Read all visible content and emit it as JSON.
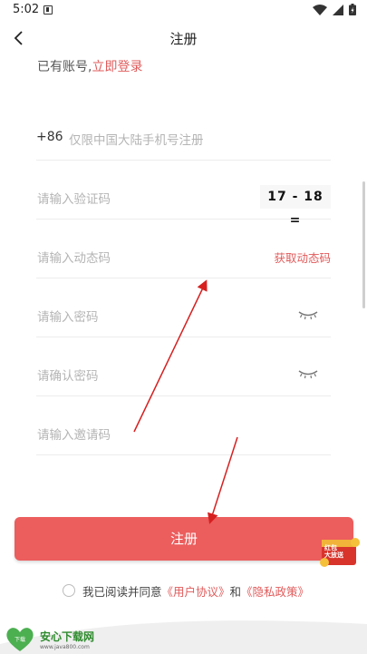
{
  "statusbar": {
    "time": "5:02"
  },
  "nav": {
    "title": "注册"
  },
  "login_hint": {
    "text": "已有账号,",
    "link": "立即登录"
  },
  "phone": {
    "prefix": "+86",
    "placeholder": "仅限中国大陆手机号注册"
  },
  "captcha": {
    "placeholder": "请输入验证码",
    "image_text": "17 - 18 ="
  },
  "dynamic_code": {
    "placeholder": "请输入动态码",
    "button": "获取动态码"
  },
  "password": {
    "placeholder": "请输入密码"
  },
  "confirm_password": {
    "placeholder": "请确认密码"
  },
  "invite": {
    "placeholder": "请输入邀请码"
  },
  "register_button": "注册",
  "agreement": {
    "prefix": "我已阅读并同意",
    "terms": "《用户协议》",
    "and": "和",
    "privacy": "《隐私政策》"
  },
  "watermark": {
    "brand": "安心下载网",
    "url": "www.java800.com",
    "logo_text": "下载"
  },
  "promo_badge": {
    "line1": "红包",
    "line2": "大放送"
  },
  "colors": {
    "accent": "#ec5d5d",
    "link": "#e05a5a",
    "placeholder": "#b4b4b4",
    "divider": "#ececec"
  }
}
